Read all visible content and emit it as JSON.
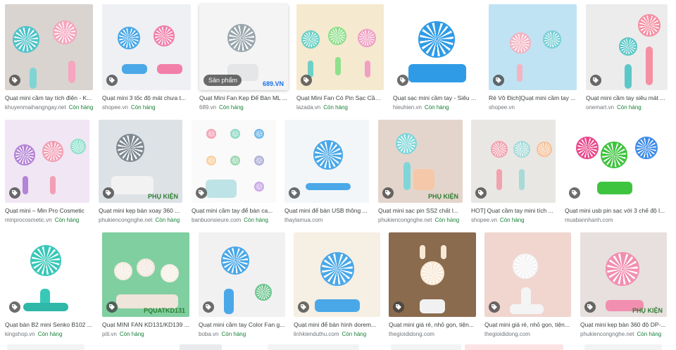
{
  "results": [
    {
      "title": "Quạt mini cầm tay tích điện - K...",
      "source": "khuyenmaihangngay.net",
      "stock": "Còn hàng",
      "icon": "tag-icon"
    },
    {
      "title": "Quạt mini 3 tốc độ mát chưa t...",
      "source": "shopee.vn",
      "stock": "Còn hàng",
      "icon": "tag-icon"
    },
    {
      "title": "Quạt Mini Fan Kẹp Để Bàn ML ...",
      "source": "689.vn",
      "stock": "Còn hàng",
      "badge": "Sản phẩm",
      "icon": "tag-icon",
      "watermark": "689.VN"
    },
    {
      "title": "Quạt Mini Fan Có Pin Sạc Cầm...",
      "source": "lazada.vn",
      "stock": "Còn hàng",
      "icon": "tag-icon"
    },
    {
      "title": "Quạt sạc mini cầm tay - Siêu ...",
      "source": "hieuhien.vn",
      "stock": "Còn hàng",
      "icon": "tag-icon"
    },
    {
      "title": "Rẻ Vô Địch]Quạt mini cầm tay ...",
      "source": "shopee.vn",
      "stock": "",
      "icon": "tag-icon"
    },
    {
      "title": "Quạt mini cầm tay siêu mát ...",
      "source": "onemart.vn",
      "stock": "Còn hàng",
      "icon": "tag-icon"
    },
    {
      "title": "Quạt mini – Min Pro Cosmetic",
      "source": "minprocosmetic.vn",
      "stock": "Còn hàng",
      "icon": "tag-icon"
    },
    {
      "title": "Quạt mini kẹp bàn xoay 360 ...",
      "source": "phukiencongnghe.net",
      "stock": "Còn hàng",
      "icon": "tag-icon",
      "watermark": "PHỤ KIỆN"
    },
    {
      "title": "Quạt mini cầm tay để bàn ca...",
      "source": "banbuonsieure.com",
      "stock": "Còn hàng",
      "icon": "tag-icon"
    },
    {
      "title": "Quạt mini để bàn USB thông ...",
      "source": "thaylamua.com",
      "stock": "",
      "icon": "tag-icon"
    },
    {
      "title": "Quạt mini sạc pin SS2 chất l...",
      "source": "phukiencongnghe.net",
      "stock": "Còn hàng",
      "icon": "tag-icon",
      "watermark": "PHỤ KIỆN"
    },
    {
      "title": "HOT] Quạt cầm tay mini tích ...",
      "source": "shopee.vn",
      "stock": "Còn hàng",
      "icon": "tag-icon"
    },
    {
      "title": "Quạt mini usb pin sạc với 3 chế độ l...",
      "source": "muabannhanh.com",
      "stock": "",
      "icon": "tag-icon"
    },
    {
      "title": "Quạt bàn B2 mini Senko B102 ...",
      "source": "kingshop.vn",
      "stock": "Còn hàng",
      "icon": "tag-icon"
    },
    {
      "title": "Quạt MINI FAN KD131/KD139 ...",
      "source": "piti.vn",
      "stock": "Còn hàng",
      "icon": "tag-icon",
      "watermark": "PQUATKD131"
    },
    {
      "title": "Quạt mini cầm tay Color Fan g...",
      "source": "boba.vn",
      "stock": "Còn hàng",
      "icon": "tag-icon"
    },
    {
      "title": "Quạt mini để bàn hình dorem...",
      "source": "linhkienduthu.com",
      "stock": "Còn hàng",
      "icon": "tag-icon"
    },
    {
      "title": "Quạt mini giá rẻ, nhỏ gọn, tiện...",
      "source": "thegioididong.com",
      "stock": "",
      "icon": "tag-icon"
    },
    {
      "title": "Quạt mini giá rẻ, nhỏ gọn, tiện...",
      "source": "thegioididong.com",
      "stock": "",
      "icon": "tag-icon"
    },
    {
      "title": "Quạt mini kẹp bàn 360 độ DP-...",
      "source": "phukiencongnghe.net",
      "stock": "Còn hàng",
      "icon": "tag-icon",
      "watermark": "PHỤ KIỆN"
    }
  ],
  "colors": {
    "link_green": "#188038",
    "meta_gray": "#70757a",
    "title_gray": "#3c4043"
  }
}
